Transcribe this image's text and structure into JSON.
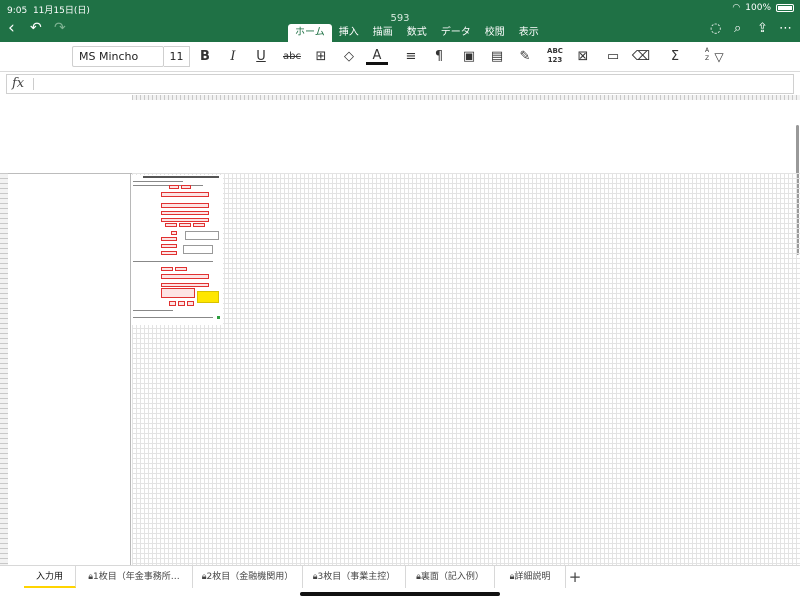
{
  "status": {
    "time": "9:05",
    "date": "11月15日(日)",
    "battery": "100%"
  },
  "app": {
    "title": "593"
  },
  "tabs": [
    "ホーム",
    "挿入",
    "描画",
    "数式",
    "データ",
    "校閲",
    "表示"
  ],
  "ribbon": {
    "font_name": "MS Mincho",
    "font_size": "11",
    "bold": "B",
    "italic": "I",
    "underline": "U",
    "strike": "abc",
    "font_color": "A",
    "abc123_top": "ABC",
    "abc123_bottom": "123",
    "sum": "Σ",
    "sort_a": "A",
    "sort_z": "Z"
  },
  "formula": {
    "fx": "fx"
  },
  "sheet_tabs": [
    "入力用",
    "1枚目（年金事務所…",
    "2枚目（金融機関用）",
    "3枚目（事業主控）",
    "裏面（記入例）",
    "詳細説明"
  ],
  "colors": {
    "accent": "#1f7145",
    "active_tab_underline": "#ffd400",
    "form_box": "#e03131"
  }
}
